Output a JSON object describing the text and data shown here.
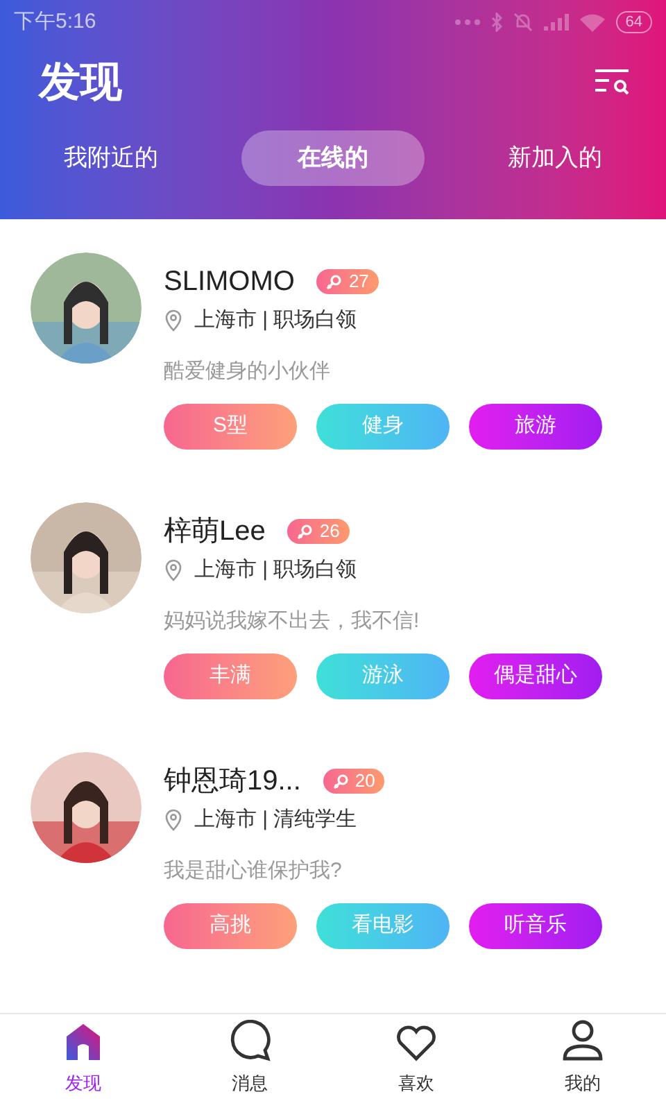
{
  "status_bar": {
    "time": "下午5:16",
    "battery": "64"
  },
  "header": {
    "title": "发现"
  },
  "tabs": [
    {
      "label": "我附近的",
      "selected": false
    },
    {
      "label": "在线的",
      "selected": true
    },
    {
      "label": "新加入的",
      "selected": false
    }
  ],
  "users": [
    {
      "name": "SLIMOMO",
      "age": "27",
      "location": "上海市 | 职场白领",
      "bio": "酷爱健身的小伙伴",
      "tags": [
        "S型",
        "健身",
        "旅游"
      ]
    },
    {
      "name": "梓萌Lee",
      "age": "26",
      "location": "上海市 | 职场白领",
      "bio": "妈妈说我嫁不出去，我不信!",
      "tags": [
        "丰满",
        "游泳",
        "偶是甜心"
      ]
    },
    {
      "name": "钟恩琦19...",
      "age": "20",
      "location": "上海市 | 清纯学生",
      "bio": "我是甜心谁保护我?",
      "tags": [
        "高挑",
        "看电影",
        "听音乐"
      ]
    }
  ],
  "bottom_nav": [
    {
      "label": "发现",
      "kind": "home",
      "selected": true
    },
    {
      "label": "消息",
      "kind": "chat",
      "selected": false
    },
    {
      "label": "喜欢",
      "kind": "heart",
      "selected": false
    },
    {
      "label": "我的",
      "kind": "person",
      "selected": false
    }
  ]
}
